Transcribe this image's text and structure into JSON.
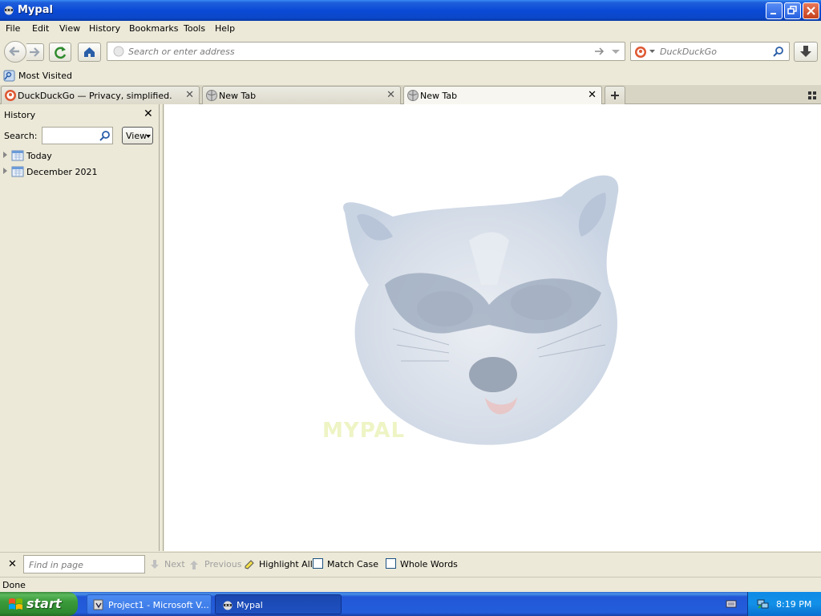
{
  "window": {
    "title": "Mypal"
  },
  "menu": {
    "items": [
      "File",
      "Edit",
      "View",
      "History",
      "Bookmarks",
      "Tools",
      "Help"
    ]
  },
  "navbar": {
    "url_placeholder": "Search or enter address",
    "search_engine": "DuckDuckGo"
  },
  "bookmarks": {
    "items": [
      "Most Visited"
    ]
  },
  "tabs": [
    {
      "label": "DuckDuckGo — Privacy, simplified.",
      "active": false
    },
    {
      "label": "New Tab",
      "active": false
    },
    {
      "label": "New Tab",
      "active": true
    }
  ],
  "sidebar": {
    "title": "History",
    "search_label": "Search:",
    "view_label": "View",
    "tree": [
      "Today",
      "December 2021"
    ]
  },
  "content": {
    "logo_text": "MYPAL"
  },
  "findbar": {
    "placeholder": "Find in page",
    "next": "Next",
    "previous": "Previous",
    "highlight_all": "Highlight All",
    "match_case": "Match Case",
    "whole_words": "Whole Words"
  },
  "status": {
    "text": "Done"
  },
  "taskbar": {
    "start": "start",
    "tasks": [
      "Project1 - Microsoft V...",
      "Mypal"
    ],
    "clock": "8:19 PM"
  },
  "colors": {
    "titlebar": "#0a4ad6",
    "taskbar": "#245edb",
    "start": "#3a9a3a",
    "chrome": "#ece9d8"
  }
}
